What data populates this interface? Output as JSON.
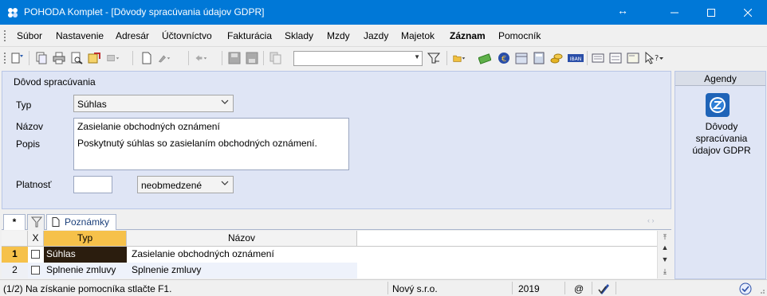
{
  "window": {
    "title": "POHODA Komplet - [Dôvody spracúvania údajov GDPR]"
  },
  "menu": {
    "items": [
      "Súbor",
      "Nastavenie",
      "Adresár",
      "Účtovníctvo",
      "Fakturácia",
      "Sklady",
      "Mzdy",
      "Jazdy",
      "Majetok",
      "Záznam",
      "Pomocník"
    ]
  },
  "toolbar": {
    "search_value": ""
  },
  "form": {
    "section_title": "Dôvod spracúvania",
    "typ_label": "Typ",
    "typ_value": "Súhlas",
    "nazov_label": "Názov",
    "nazov_value": "Zasielanie obchodných oznámení",
    "popis_label": "Popis",
    "popis_value": "Poskytnutý súhlas so zasielaním obchodných oznámení.",
    "platnost_label": "Platnosť",
    "platnost_value": "",
    "platnost_option": "neobmedzené"
  },
  "agendy": {
    "header": "Agendy",
    "item_label": "Dôvody spracúvania údajov GDPR"
  },
  "tabs": {
    "asterisk": "*",
    "notes": "Poznámky"
  },
  "table": {
    "col_check": "X",
    "col_typ": "Typ",
    "col_nazov": "Názov",
    "rows": [
      {
        "num": "1",
        "typ": "Súhlas",
        "nazov": "Zasielanie obchodných oznámení"
      },
      {
        "num": "2",
        "typ": "Splnenie zmluvy",
        "nazov": "Splnenie zmluvy"
      }
    ]
  },
  "status": {
    "hint": "(1/2) Na získanie pomocníka stlačte F1.",
    "company": "Nový s.r.o.",
    "year": "2019",
    "at": "@"
  },
  "colors": {
    "titlebar": "#0078d7",
    "panel": "#dfe5f5",
    "selected_header": "#f6c14a",
    "selected_cell": "#2b1d0e"
  }
}
